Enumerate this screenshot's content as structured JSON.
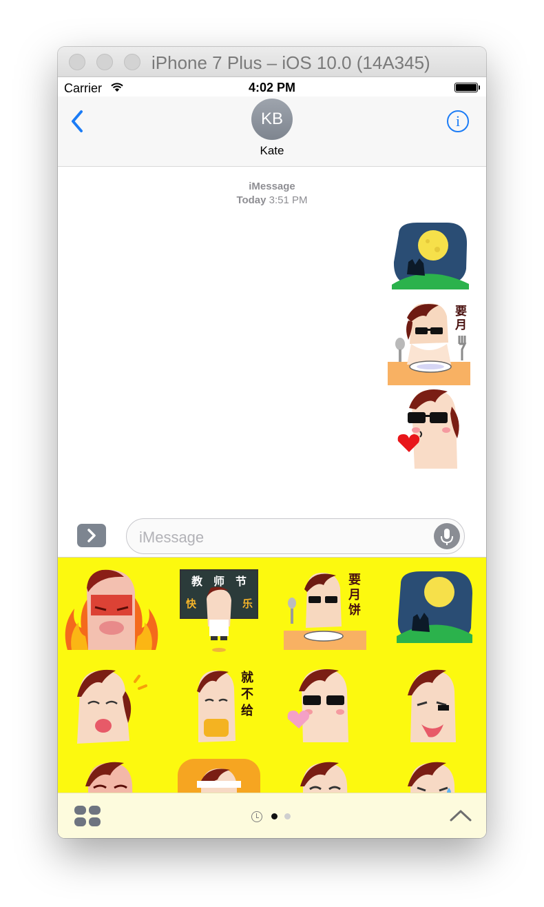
{
  "window": {
    "title": "iPhone 7 Plus – iOS 10.0 (14A345)"
  },
  "status_bar": {
    "carrier": "Carrier",
    "time": "4:02 PM"
  },
  "conversation": {
    "contact_initials": "KB",
    "contact_name": "Kate",
    "service": "iMessage",
    "date_label": "Today",
    "time_label": "3:51 PM"
  },
  "input": {
    "placeholder": "iMessage"
  },
  "sticker_text": {
    "teacher_day": [
      "教",
      "师",
      "节"
    ],
    "happy": [
      "快",
      "乐"
    ],
    "want_mooncake": [
      "要",
      "月",
      "饼"
    ],
    "wont_give": [
      "就",
      "不",
      "给"
    ]
  },
  "page_indicator": {
    "pages": 2,
    "active_index": 0
  },
  "colors": {
    "accent": "#1b7cf6",
    "drawer_background": "#fcf90f",
    "footer_background": "#fdfbdd"
  }
}
